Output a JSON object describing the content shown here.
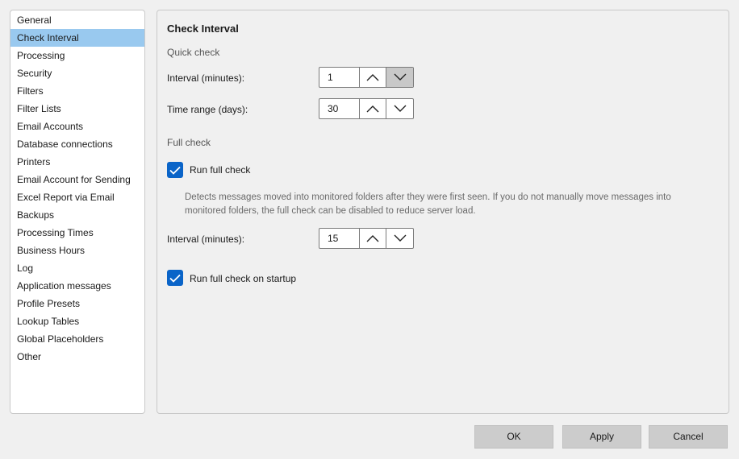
{
  "sidebar": {
    "items": [
      {
        "label": "General"
      },
      {
        "label": "Check Interval",
        "selected": true
      },
      {
        "label": "Processing"
      },
      {
        "label": "Security"
      },
      {
        "label": "Filters"
      },
      {
        "label": "Filter Lists"
      },
      {
        "label": "Email Accounts"
      },
      {
        "label": "Database connections"
      },
      {
        "label": "Printers"
      },
      {
        "label": "Email Account for Sending"
      },
      {
        "label": "Excel Report via Email"
      },
      {
        "label": "Backups"
      },
      {
        "label": "Processing Times"
      },
      {
        "label": "Business Hours"
      },
      {
        "label": "Log"
      },
      {
        "label": "Application messages"
      },
      {
        "label": "Profile Presets"
      },
      {
        "label": "Lookup Tables"
      },
      {
        "label": "Global Placeholders"
      },
      {
        "label": "Other"
      }
    ]
  },
  "panel": {
    "title": "Check Interval",
    "quick_check": {
      "heading": "Quick check",
      "interval_label": "Interval (minutes):",
      "interval_value": "1",
      "range_label": "Time range (days):",
      "range_value": "30"
    },
    "full_check": {
      "heading": "Full check",
      "run_label": "Run full check",
      "run_checked": true,
      "description": "Detects messages moved into monitored folders after they were first seen. If you do not manually move messages into monitored folders, the full check can be disabled to reduce server load.",
      "interval_label": "Interval (minutes):",
      "interval_value": "15",
      "startup_label": "Run full check on startup",
      "startup_checked": true
    }
  },
  "footer": {
    "ok_label": "OK",
    "apply_label": "Apply",
    "cancel_label": "Cancel"
  },
  "colors": {
    "selection": "#99c9ef",
    "checkbox": "#0a64c8",
    "button": "#cccccc"
  }
}
